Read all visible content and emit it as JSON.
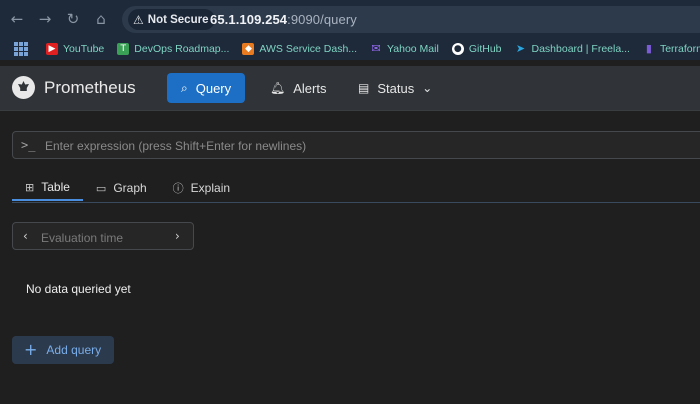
{
  "browser": {
    "security_label": "Not Secure",
    "url_host": "65.1.109.254",
    "url_rest": ":9090/query",
    "bookmarks": [
      {
        "label": "YouTube",
        "color": "#e02020",
        "glyph": "▶"
      },
      {
        "label": "DevOps Roadmap...",
        "color": "#3aa055",
        "glyph": "T"
      },
      {
        "label": "AWS Service Dash...",
        "color": "#e87a20",
        "glyph": "◆"
      },
      {
        "label": "Yahoo Mail",
        "color": "#7b3ff2",
        "glyph": "✉"
      },
      {
        "label": "GitHub",
        "color": "#ffffff",
        "glyph": "●"
      },
      {
        "label": "Dashboard | Freela...",
        "color": "#2aa6e0",
        "glyph": "➤"
      },
      {
        "label": "Terraform",
        "color": "#7b5cd6",
        "glyph": "▮"
      }
    ]
  },
  "app": {
    "brand": "Prometheus",
    "nav": {
      "query": "Query",
      "alerts": "Alerts",
      "status": "Status"
    },
    "expression_placeholder": "Enter expression (press Shift+Enter for newlines)",
    "tabs": {
      "table": "Table",
      "graph": "Graph",
      "explain": "Explain"
    },
    "evaluation_placeholder": "Evaluation time",
    "empty_message": "No data queried yet",
    "add_query": "Add query"
  },
  "colors": {
    "accent": "#1c6fc4",
    "nav_bg": "#303438",
    "page_bg": "#1f1f1f"
  }
}
